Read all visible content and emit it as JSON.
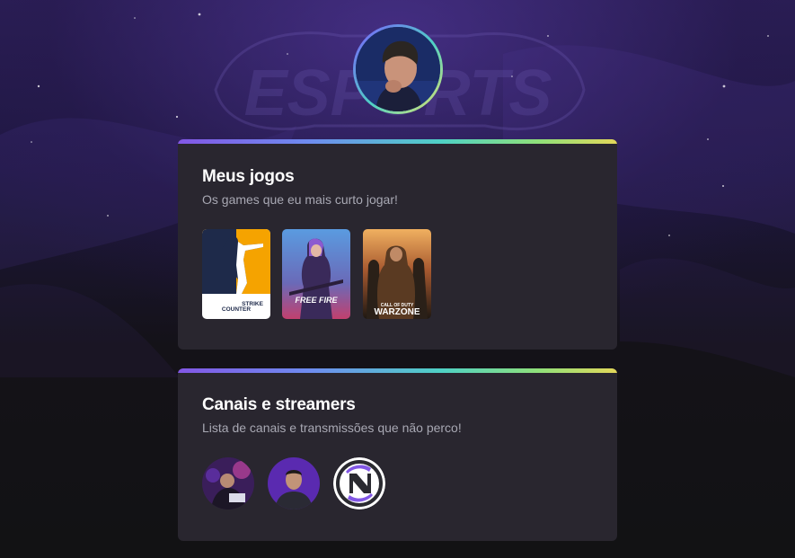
{
  "background": {
    "watermark_text": "ESPORTS"
  },
  "profile": {
    "avatar_icon": "profile-photo"
  },
  "games_section": {
    "title": "Meus jogos",
    "subtitle": "Os games que eu mais curto jogar!",
    "games": [
      {
        "name": "Counter-Strike",
        "logo_line1": "COUNTER",
        "logo_line2": "STRIKE",
        "colors": {
          "top": "#f5a300",
          "silhouette": "#1e2a4a",
          "bottom": "#ffffff"
        }
      },
      {
        "name": "Free Fire",
        "logo_text": "FREE FIRE",
        "colors": {
          "sky": "#4d86d6",
          "glow": "#e0457b"
        }
      },
      {
        "name": "Call of Duty Warzone",
        "logo_line1": "CALL OF DUTY",
        "logo_line2": "WARZONE",
        "colors": {
          "sky": "#e89a4a",
          "dark": "#2a2018"
        }
      }
    ]
  },
  "streamers_section": {
    "title": "Canais e streamers",
    "subtitle": "Lista de canais e transmissões que não perco!",
    "streamers": [
      {
        "name": "streamer-1",
        "icon": "streamer-avatar-1"
      },
      {
        "name": "streamer-2",
        "icon": "streamer-avatar-2"
      },
      {
        "name": "streamer-3",
        "icon": "channel-logo"
      }
    ]
  },
  "colors": {
    "card_bg": "#29262f",
    "page_bg": "#121214",
    "accent_gradient": [
      "#8257e5",
      "#4fd1c5",
      "#e3d85a"
    ]
  }
}
